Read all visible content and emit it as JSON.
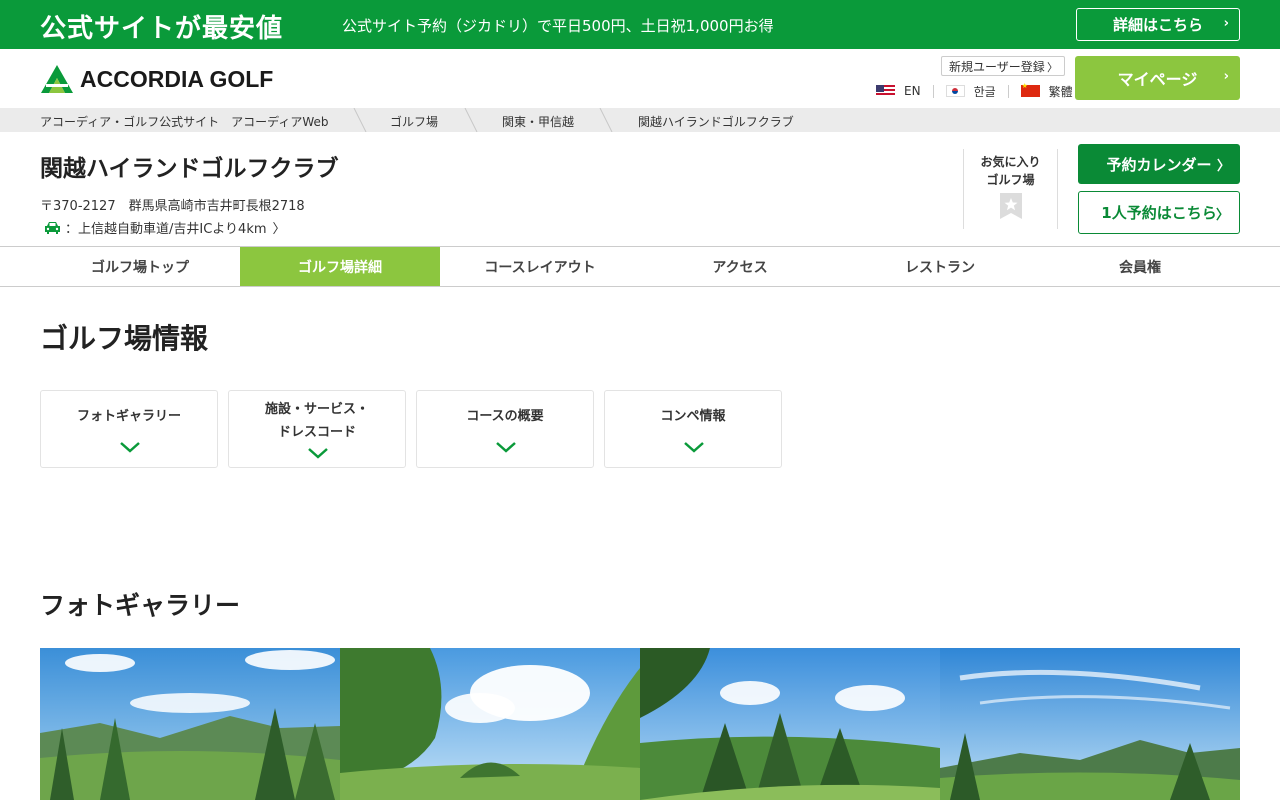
{
  "banner": {
    "title": "公式サイトが最安値",
    "subtitle": "公式サイト予約（ジカドリ）で平日500円、土日祝1,000円お得",
    "details_label": "詳細はこちら"
  },
  "header": {
    "logo_text": "ACCORDIA GOLF",
    "register_label": "新規ユーザー登録",
    "mypage_label": "マイページ",
    "languages": [
      "EN",
      "한글",
      "繁體"
    ]
  },
  "breadcrumb": [
    "アコーディア・ゴルフ公式サイト　アコーディアWeb",
    "ゴルフ場",
    "関東・甲信越",
    "関越ハイランドゴルフクラブ"
  ],
  "club": {
    "name": "関越ハイランドゴルフクラブ",
    "address": "〒370-2127　群馬県高崎市吉井町長根2718",
    "access": "上信越自動車道/吉井ICより4km",
    "favorite_label_1": "お気に入り",
    "favorite_label_2": "ゴルフ場",
    "calendar_label": "予約カレンダー",
    "solo_label": "1人予約はこちら"
  },
  "tabs": [
    "ゴルフ場トップ",
    "ゴルフ場詳細",
    "コースレイアウト",
    "アクセス",
    "レストラン",
    "会員権"
  ],
  "active_tab": "ゴルフ場詳細",
  "section": {
    "title": "ゴルフ場情報",
    "cards": [
      {
        "line1": "フォトギャラリー",
        "line2": ""
      },
      {
        "line1": "施設・サービス・",
        "line2": "ドレスコード"
      },
      {
        "line1": "コースの概要",
        "line2": ""
      },
      {
        "line1": "コンペ情報",
        "line2": ""
      }
    ]
  },
  "gallery": {
    "title": "フォトギャラリー"
  },
  "colors": {
    "brand_green": "#0a9a3a",
    "accent_lime": "#8cc63f",
    "dark_green": "#0a8a36"
  }
}
